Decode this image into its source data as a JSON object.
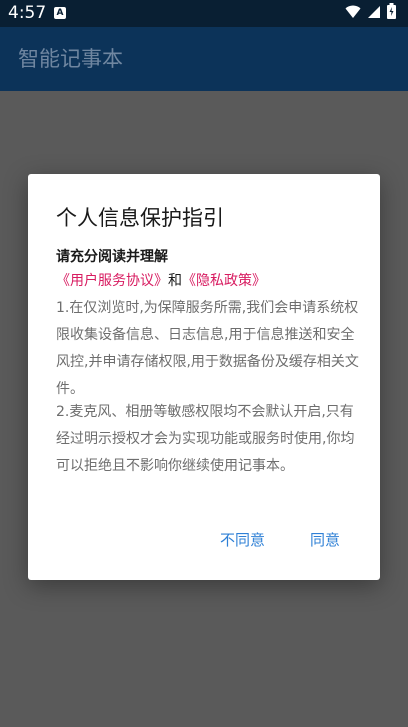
{
  "status_bar": {
    "time": "4:57",
    "notification_badge": "A",
    "icons": [
      "wifi-icon",
      "signal-icon",
      "battery-icon"
    ]
  },
  "app_bar": {
    "title": "智能记事本"
  },
  "dialog": {
    "title": "个人信息保护指引",
    "subtitle": "请充分阅读并理解",
    "user_agreement_link": "《用户服务协议》",
    "connector": "和",
    "privacy_policy_link": "《隐私政策》",
    "paragraph_1": "1.在仅浏览时,为保障服务所需,我们会申请系统权限收集设备信息、日志信息,用于信息推送和安全风控,并申请存储权限,用于数据备份及缓存相关文件。",
    "paragraph_2": "2.麦克风、相册等敏感权限均不会默认开启,只有经过明示授权才会为实现功能或服务时使用,你均可以拒绝且不影响你继续使用记事本。",
    "disagree_button": "不同意",
    "agree_button": "同意"
  },
  "colors": {
    "status_bar_bg": "#091f33",
    "app_bar_bg": "#0c3359",
    "overlay_bg": "#5a5a5a",
    "link_color": "#d81b60",
    "button_color": "#2f80d6"
  }
}
